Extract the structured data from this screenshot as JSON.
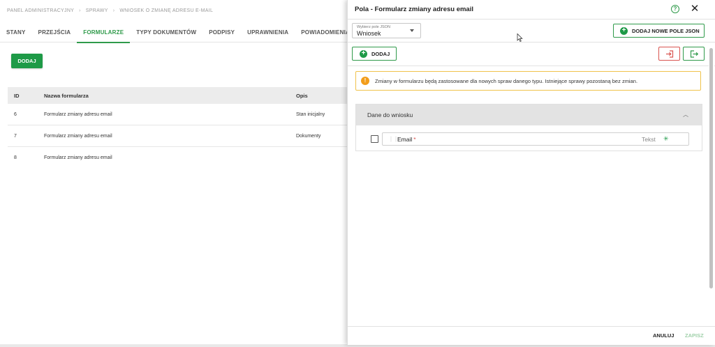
{
  "breadcrumb": [
    "PANEL ADMINISTRACYJNY",
    "SPRAWY",
    "WNIOSEK O ZMIANĘ ADRESU E-MAIL"
  ],
  "tabs": [
    {
      "label": "STANY",
      "active": false
    },
    {
      "label": "PRZEJŚCIA",
      "active": false
    },
    {
      "label": "FORMULARZE",
      "active": true
    },
    {
      "label": "TYPY DOKUMENTÓW",
      "active": false
    },
    {
      "label": "PODPISY",
      "active": false
    },
    {
      "label": "UPRAWNIENIA",
      "active": false
    },
    {
      "label": "POWIADOMIENIA",
      "active": false
    }
  ],
  "main": {
    "add_button": "DODAJ",
    "table": {
      "headers": [
        "ID",
        "Nazwa formularza",
        "Opis"
      ],
      "rows": [
        [
          "6",
          "Formularz zmiany adresu email",
          "Stan inicjalny"
        ],
        [
          "7",
          "Formularz zmiany adresu email",
          "Dokumenty"
        ],
        [
          "8",
          "Formularz zmiany adresu email",
          ""
        ]
      ]
    }
  },
  "drawer": {
    "title": "Pola - Formularz zmiany adresu email",
    "help_icon": "?",
    "close_icon": "✕",
    "select": {
      "label": "Wybierz pole JSON",
      "value": "Wniosek"
    },
    "add_json_button": "DODAJ NOWE POLE JSON",
    "add_button": "DODAJ",
    "alert": "Zmiany w formularzu będą zastosowane dla nowych spraw danego typu. Istniejące sprawy pozostaną bez zmian.",
    "section": {
      "title": "Dane do wniosku",
      "fields": [
        {
          "name": "Email",
          "required_mark": "*",
          "type": "Tekst"
        }
      ]
    },
    "footer": {
      "cancel": "ANULUJ",
      "save": "ZAPISZ"
    }
  },
  "colors": {
    "accent": "#2f9a4a",
    "primary_button": "#1e9a47",
    "warning": "#f29d1a",
    "danger": "#d9534f"
  }
}
